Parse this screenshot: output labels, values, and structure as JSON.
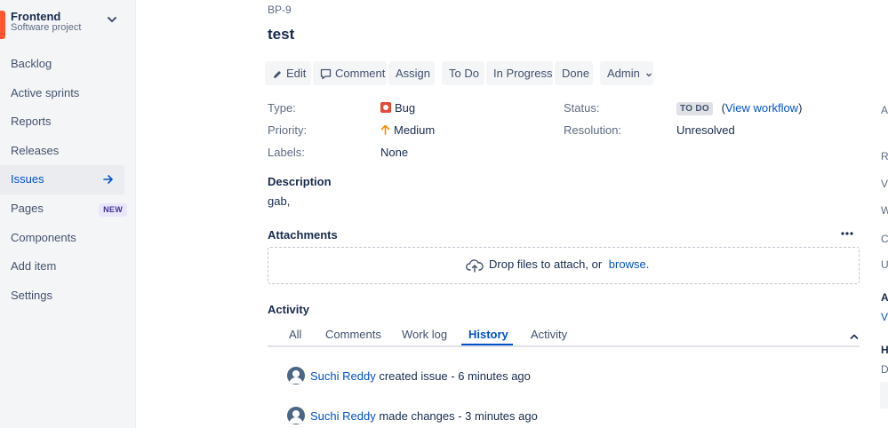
{
  "project": {
    "name": "Frontend",
    "type": "Software project"
  },
  "sidebar": {
    "items": [
      {
        "label": "Backlog"
      },
      {
        "label": "Active sprints"
      },
      {
        "label": "Reports"
      },
      {
        "label": "Releases"
      },
      {
        "label": "Issues"
      },
      {
        "label": "Pages",
        "badge": "NEW"
      },
      {
        "label": "Components"
      },
      {
        "label": "Add item"
      },
      {
        "label": "Settings"
      }
    ],
    "active_index": 4
  },
  "issue": {
    "key": "BP-9",
    "title": "test"
  },
  "toolbar": {
    "edit": "Edit",
    "comment": "Comment",
    "assign": "Assign",
    "to_do": "To Do",
    "in_progress": "In Progress",
    "done": "Done",
    "admin": "Admin"
  },
  "fields": {
    "type_label": "Type:",
    "type_value": "Bug",
    "priority_label": "Priority:",
    "priority_value": "Medium",
    "labels_label": "Labels:",
    "labels_value": "None",
    "status_label": "Status:",
    "status_value": "TO DO",
    "view_workflow": "View workflow",
    "resolution_label": "Resolution:",
    "resolution_value": "Unresolved"
  },
  "description": {
    "title": "Description",
    "text": "gab,"
  },
  "attachments": {
    "title": "Attachments",
    "drop_text": "Drop files to attach, or",
    "browse": "browse."
  },
  "activity": {
    "title": "Activity",
    "tabs": [
      "All",
      "Comments",
      "Work log",
      "History",
      "Activity"
    ],
    "active_tab": "History",
    "entries": [
      {
        "user": "Suchi Reddy",
        "action": "created issue - 6 minutes ago"
      },
      {
        "user": "Suchi Reddy",
        "action": "made changes - 3 minutes ago"
      }
    ]
  },
  "right_column": {
    "letters": [
      "A",
      "R",
      "V",
      "W",
      "C",
      "U",
      "A",
      "V",
      "H",
      "D"
    ]
  },
  "colors": {
    "accent": "#0052cc",
    "bug": "#e5493a",
    "priority_medium": "#ff8b00",
    "sidebar_bg": "#f4f5f7",
    "project_icon": "#ff5630"
  }
}
